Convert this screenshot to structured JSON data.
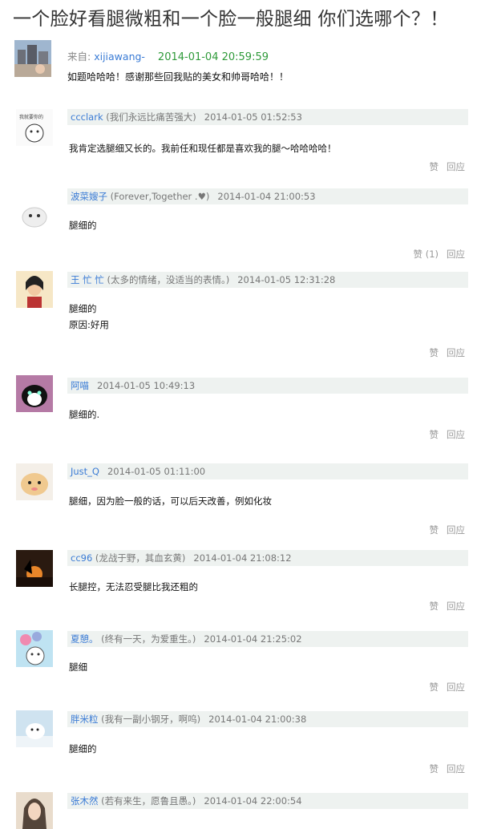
{
  "post": {
    "title": "一个脸好看腿微粗和一个脸一般腿细 你们选哪个？！",
    "from_label": "来自:",
    "author": "xijiawang-",
    "time": "2014-01-04 20:59:59",
    "body": "如题哈哈哈！感谢那些回我贴的美女和帅哥哈哈！！"
  },
  "comments": [
    {
      "user": "ccclark",
      "sig": "(我们永远比痛苦强大)",
      "time": "2014-01-05 01:52:53",
      "lines": [
        "我肯定选腿细又长的。我前任和现任都是喜欢我的腿～哈哈哈哈！"
      ],
      "like": "赞",
      "reply": "回应"
    },
    {
      "user": "波菜嫂子",
      "sig": "(Forever,Together .♥)",
      "time": "2014-01-04 21:00:53",
      "lines": [
        "腿细的"
      ],
      "like": "赞 (1)",
      "reply": "回应"
    },
    {
      "user": "王 忙 忙",
      "sig": "(太多的情绪，没适当的表情。)",
      "time": "2014-01-05 12:31:28",
      "lines": [
        "腿细的",
        "原因:好用"
      ],
      "like": "赞",
      "reply": "回应"
    },
    {
      "user": "阿喵",
      "sig": "",
      "time": "2014-01-05 10:49:13",
      "lines": [
        "腿细的."
      ],
      "like": "赞",
      "reply": "回应"
    },
    {
      "user": "Just_Q",
      "sig": "",
      "time": "2014-01-05 01:11:00",
      "lines": [
        "腿细，因为脸一般的话，可以后天改善，例如化妆"
      ],
      "like": "赞",
      "reply": "回应"
    },
    {
      "user": "cc96",
      "sig": "(龙战于野，其血玄黄)",
      "time": "2014-01-04 21:08:12",
      "lines": [
        "长腿控，无法忍受腿比我还粗的"
      ],
      "like": "赞",
      "reply": "回应"
    },
    {
      "user": "夏憩。",
      "sig": "(终有一天，为爱重生。)",
      "time": "2014-01-04 21:25:02",
      "lines": [
        "腿细"
      ],
      "like": "赞",
      "reply": "回应"
    },
    {
      "user": "胖米粒",
      "sig": "(我有一副小钢牙，啊呜)",
      "time": "2014-01-04 21:00:38",
      "lines": [
        "腿细的"
      ],
      "like": "赞",
      "reply": "回应"
    },
    {
      "user": "张木然",
      "sig": "(若有来生，愿鲁且愚。)",
      "time": "2014-01-04 22:00:54",
      "lines": [],
      "like": "",
      "reply": ""
    }
  ],
  "avatar_icons": [
    "cityscape-photo-icon",
    "cartoon-face-icon",
    "white-pet-icon",
    "girl-drawing-icon",
    "black-cat-icon",
    "cute-cat-icon",
    "sunset-silhouette-icon",
    "balloon-character-icon",
    "polar-bear-icon",
    "woman-portrait-icon"
  ],
  "colors": {
    "link": "#3a7bd5",
    "post_time": "#2f9a3a",
    "header_bg": "#eef2f0",
    "muted": "#999999"
  }
}
